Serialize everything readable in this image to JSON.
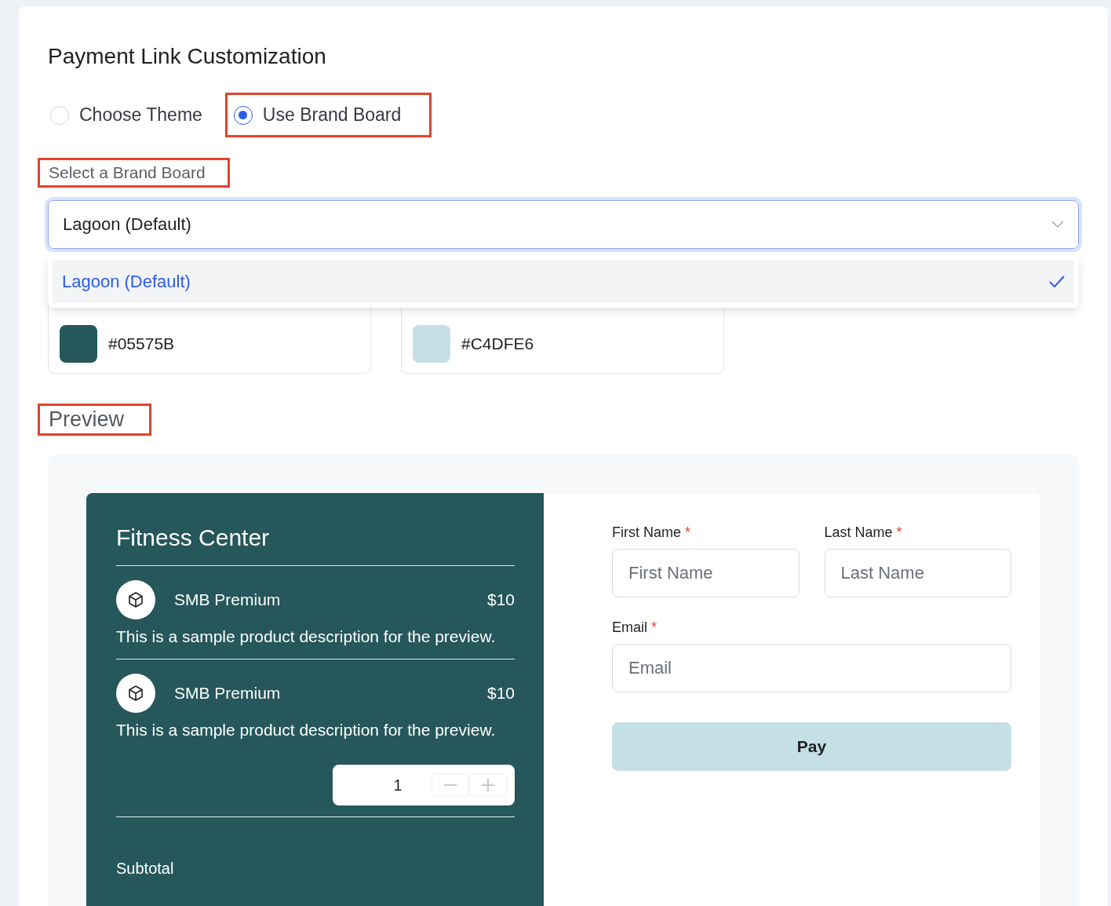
{
  "title": "Payment Link Customization",
  "theme_options": [
    {
      "label": "Choose Theme",
      "selected": false,
      "highlighted": false
    },
    {
      "label": "Use Brand Board",
      "selected": true,
      "highlighted": true
    }
  ],
  "brand_board": {
    "label": "Select a Brand Board",
    "label_highlighted": true,
    "value": "Lagoon (Default)",
    "expanded": true,
    "options": [
      {
        "label": "Lagoon (Default)",
        "selected": true
      }
    ]
  },
  "colors": [
    {
      "hex": "#05575B",
      "color": "#25575b"
    },
    {
      "hex": "#C4DFE6",
      "color": "#c4dfe6"
    }
  ],
  "preview": {
    "title": "Preview",
    "title_highlighted": true,
    "business": "Fitness Center",
    "products": [
      {
        "name": "SMB Premium",
        "price": "$10",
        "description": "This is a sample product description for the preview."
      },
      {
        "name": "SMB Premium",
        "price": "$10",
        "description": "This is a sample product description for the preview."
      }
    ],
    "quantity": "1",
    "subtotal_label": "Subtotal",
    "fields": [
      {
        "label": "First Name",
        "required_mark": "*",
        "placeholder": "First Name",
        "full_width": false
      },
      {
        "label": "Last Name",
        "required_mark": "*",
        "placeholder": "Last Name",
        "full_width": false
      },
      {
        "label": "Email",
        "required_mark": "*",
        "placeholder": "Email",
        "full_width": true
      }
    ],
    "pay_button": "Pay"
  }
}
